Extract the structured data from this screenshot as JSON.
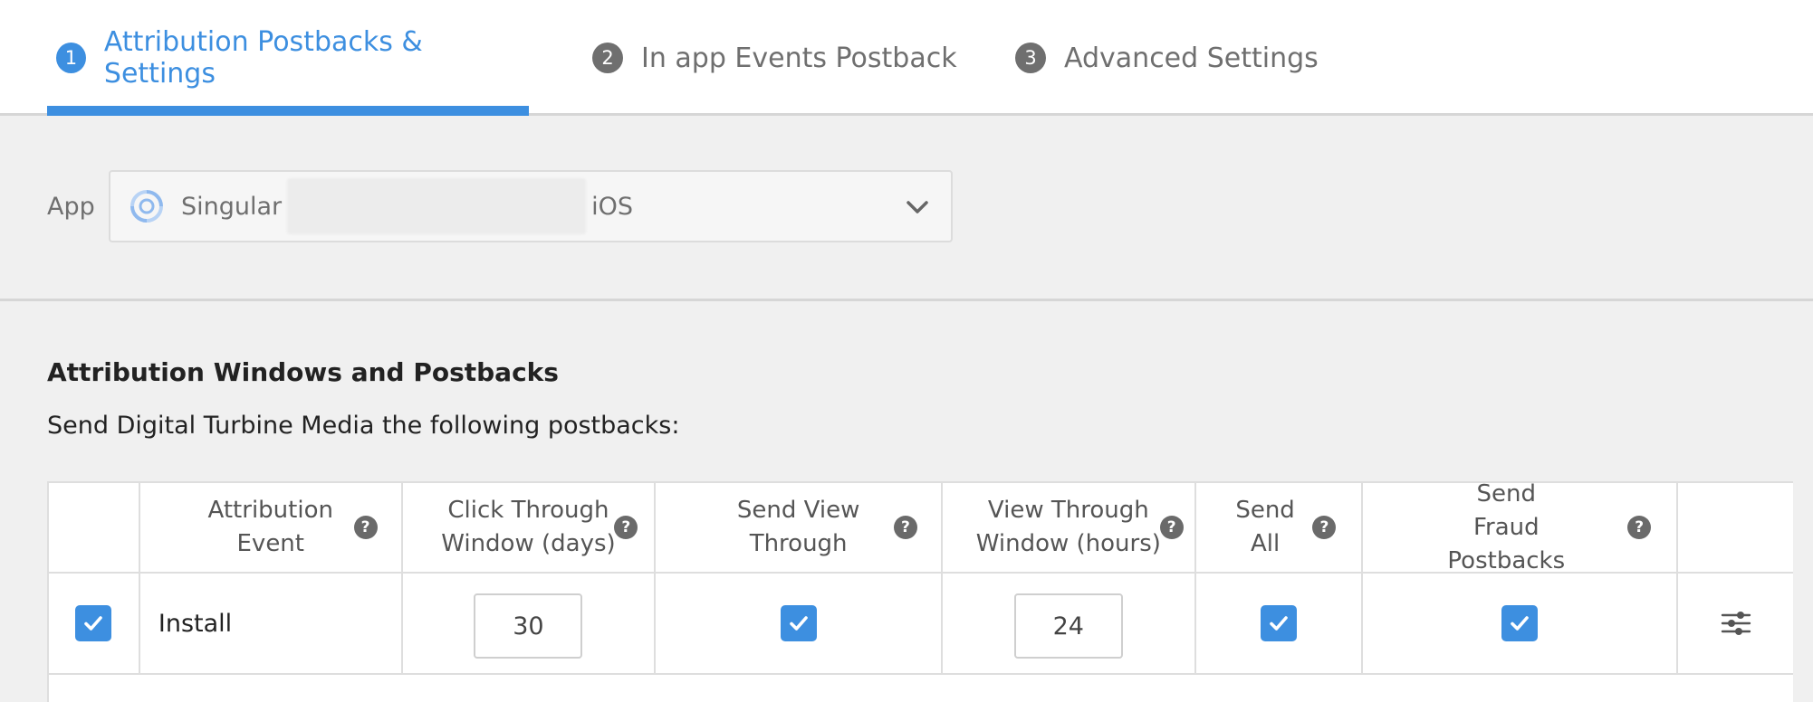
{
  "tabs": [
    {
      "num": "1",
      "label": "Attribution Postbacks & Settings"
    },
    {
      "num": "2",
      "label": "In app Events Postback"
    },
    {
      "num": "3",
      "label": "Advanced Settings"
    }
  ],
  "app": {
    "label": "App",
    "name": "Singular",
    "platform": "iOS"
  },
  "section": {
    "title": "Attribution Windows and Postbacks",
    "description": "Send Digital Turbine Media the following postbacks:"
  },
  "table": {
    "headers": [
      "Attribution Event",
      "Click Through Window (days)",
      "Send View Through",
      "View Through Window (hours)",
      "Send All",
      "Send Fraud Postbacks"
    ],
    "help_glyph": "?",
    "rows": [
      {
        "event": "Install",
        "click_through_days": "30",
        "view_through_hours": "24"
      }
    ]
  },
  "colors": {
    "accent": "#3d8fe0",
    "inactive": "#6f6f6f"
  }
}
